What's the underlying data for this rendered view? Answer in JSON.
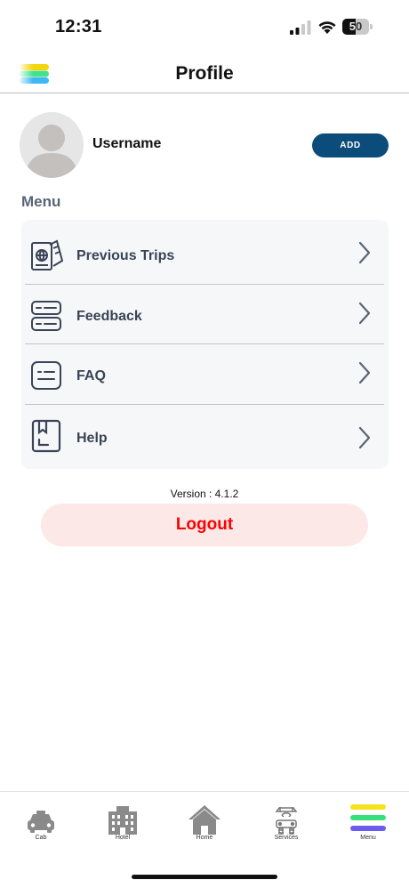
{
  "status_bar": {
    "time": "12:31",
    "battery": "50",
    "battery_level": 0.5
  },
  "header": {
    "title": "Profile",
    "logo_icon": "brand-stripes-icon"
  },
  "profile": {
    "username": "Username",
    "add_label": "ADD",
    "avatar_icon": "user-silhouette-icon"
  },
  "menu": {
    "heading": "Menu",
    "items": [
      {
        "label": "Previous Trips",
        "icon": "passport-ticket-icon"
      },
      {
        "label": "Feedback",
        "icon": "feedback-list-icon"
      },
      {
        "label": "FAQ",
        "icon": "faq-message-icon"
      },
      {
        "label": "Help",
        "icon": "help-book-icon"
      }
    ]
  },
  "version": "Version : 4.1.2",
  "logout_label": "Logout",
  "tabs": [
    {
      "label": "Cab",
      "icon": "cab-icon"
    },
    {
      "label": "Hotel",
      "icon": "hotel-icon"
    },
    {
      "label": "Home",
      "icon": "home-icon"
    },
    {
      "label": "Services",
      "icon": "services-icon"
    },
    {
      "label": "Menu",
      "icon": "menu-stripes-icon"
    }
  ],
  "colors": {
    "accent": "#0b4c7a",
    "logout_bg": "#fde8e8",
    "logout_text": "#ff0000",
    "menu_heading": "#5a6478"
  }
}
